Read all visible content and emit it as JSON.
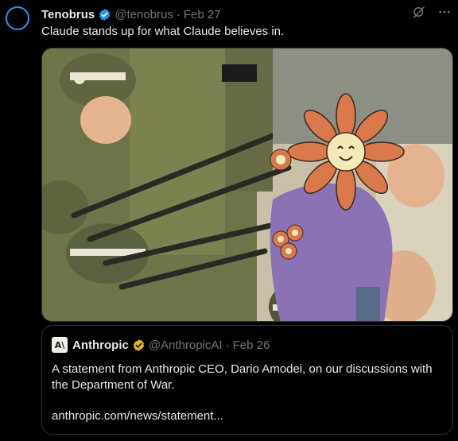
{
  "tweet": {
    "author_name": "Tenobrus",
    "handle": "@tenobrus",
    "separator": "·",
    "date": "Feb 27",
    "text": "Claude stands up for what Claude believes in.",
    "image_alt": "Illustration: a person with a smiling flower for a head offers flowers to a line of soldiers pointing rifles"
  },
  "quote": {
    "author_name": "Anthropic",
    "handle": "@AnthropicAI",
    "separator": "·",
    "date": "Feb 26",
    "logo_text": "A\\",
    "text": "A statement from Anthropic CEO, Dario Amodei, on our discussions with the Department of War.",
    "link": "anthropic.com/news/statement..."
  },
  "icons": {
    "verified": "verified-badge-icon",
    "grok": "grok-icon",
    "more": "more-options-icon"
  },
  "colors": {
    "background": "#000000",
    "text": "#e7e9ea",
    "muted": "#71767b",
    "accent": "#1d9bf0",
    "verified_blue": "#1d9bf0",
    "verified_gold": "#e2b719",
    "border": "#2f3336"
  }
}
